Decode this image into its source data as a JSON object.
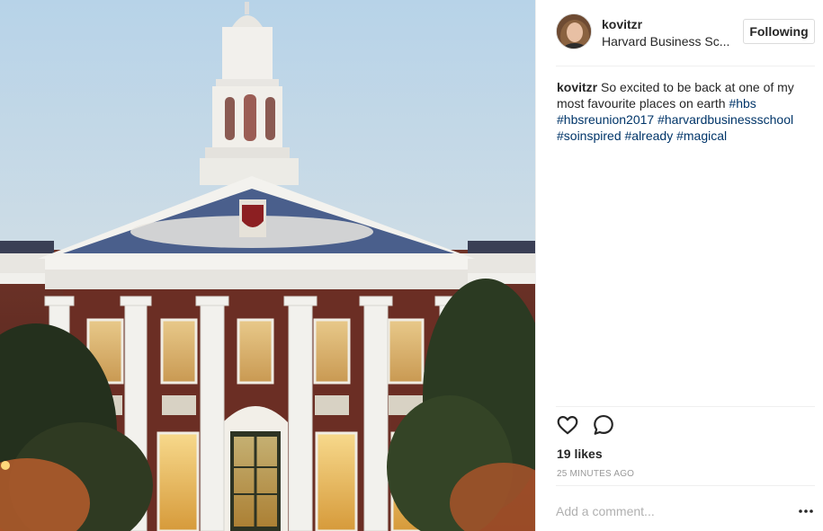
{
  "post": {
    "username": "kovitzr",
    "location": "Harvard Business Sc...",
    "follow_label": "Following",
    "caption": {
      "username": "kovitzr",
      "text": " So excited to be back at one of my most favourite places on earth ",
      "hashtags": [
        "#hbs",
        "#hbsreunion2017",
        "#harvardbusinessschool",
        "#soinspired",
        "#already",
        "#magical"
      ]
    },
    "likes": "19 likes",
    "timestamp": "25 MINUTES AGO",
    "comment_placeholder": "Add a comment..."
  },
  "icons": {
    "like": "heart-icon",
    "comment": "comment-bubble-icon",
    "more": "more-options-icon"
  },
  "colors": {
    "hashtag": "#003569",
    "text": "#262626",
    "muted": "#999999",
    "border": "#dbdbdb"
  }
}
